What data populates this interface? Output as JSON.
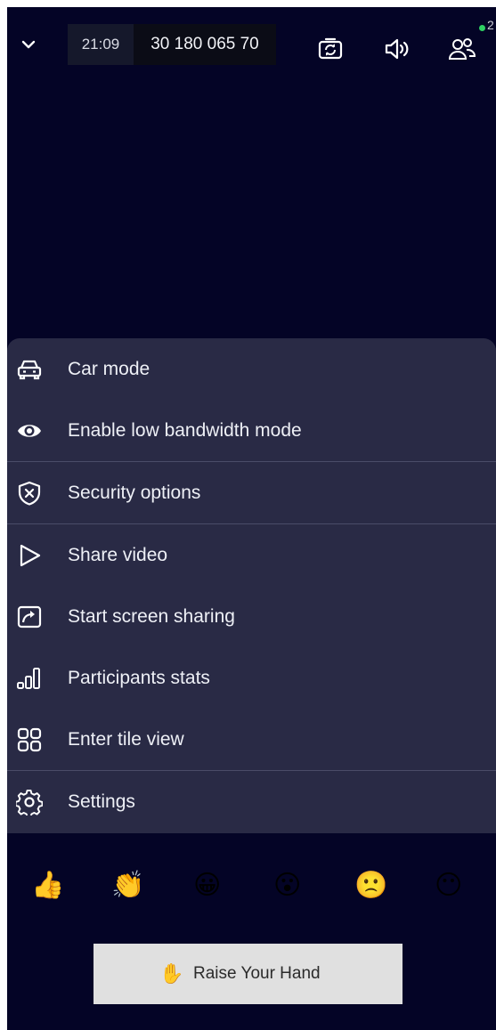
{
  "topbar": {
    "time": "21:09",
    "room_id": "30 180 065 70",
    "participant_count": "2",
    "icons": [
      "chevron-down-icon",
      "switch-camera-icon",
      "speaker-icon",
      "participants-icon"
    ]
  },
  "menu": {
    "items": [
      {
        "label": "Car mode",
        "icon": "car-icon"
      },
      {
        "label": "Enable low bandwidth mode",
        "icon": "eye-icon"
      },
      {
        "label": "Security options",
        "icon": "shield-icon"
      },
      {
        "label": "Share video",
        "icon": "play-icon"
      },
      {
        "label": "Start screen sharing",
        "icon": "screen-share-icon"
      },
      {
        "label": "Participants stats",
        "icon": "stats-icon"
      },
      {
        "label": "Enter tile view",
        "icon": "tile-view-icon"
      },
      {
        "label": "Settings",
        "icon": "gear-icon"
      }
    ]
  },
  "reactions": {
    "thumbs_up": "👍",
    "clap": "👏",
    "smile": "😀",
    "surprised": "😮",
    "sad": "🙁",
    "no_mouth": "😶"
  },
  "raise_hand": {
    "icon": "✋",
    "label": "Raise Your Hand"
  },
  "colors": {
    "background": "#040426",
    "sheet": "#292a45",
    "online_dot": "#2fcf63"
  }
}
